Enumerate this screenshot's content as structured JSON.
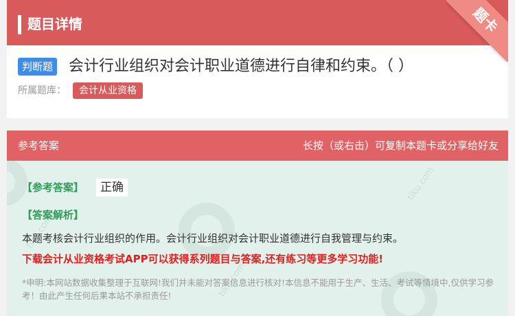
{
  "header": {
    "title": "题目详情"
  },
  "corner_badge": {
    "label": "题卡"
  },
  "question": {
    "type_badge": "判断题",
    "text": "会计行业组织对会计职业道德进行自律和约束。（    ）"
  },
  "bank": {
    "label": "所属题库：",
    "name": "会计从业资格"
  },
  "answer_section": {
    "title": "参考答案",
    "hint": "长按（或右击）可复制本题卡或分享给好友",
    "answer_label": "【参考答案】",
    "answer_value": "正确",
    "explain_label": "【答案解析】",
    "explain_text": "本题考核会计行业组织的作用。会计行业组织对会计职业道德进行自我管理与约束。",
    "promo_text": "下载会计从业资格考试APP可以获得系列题目与答案,还有练习等更多学习功能!",
    "notice_text": "*申明:本网站数据收集整理于互联网!我们并未能对答案信息进行核对!本信息不能用于生产、生活、考试等情境中,仅供学习参考！由此产生任何后果本站不承担责任!"
  },
  "colors": {
    "header_red": "#d95a5b",
    "badge_blue": "#3c8ce8",
    "answer_bg": "#e3f1ec",
    "label_green": "#2e9e58",
    "promo_red": "#e0201f"
  }
}
